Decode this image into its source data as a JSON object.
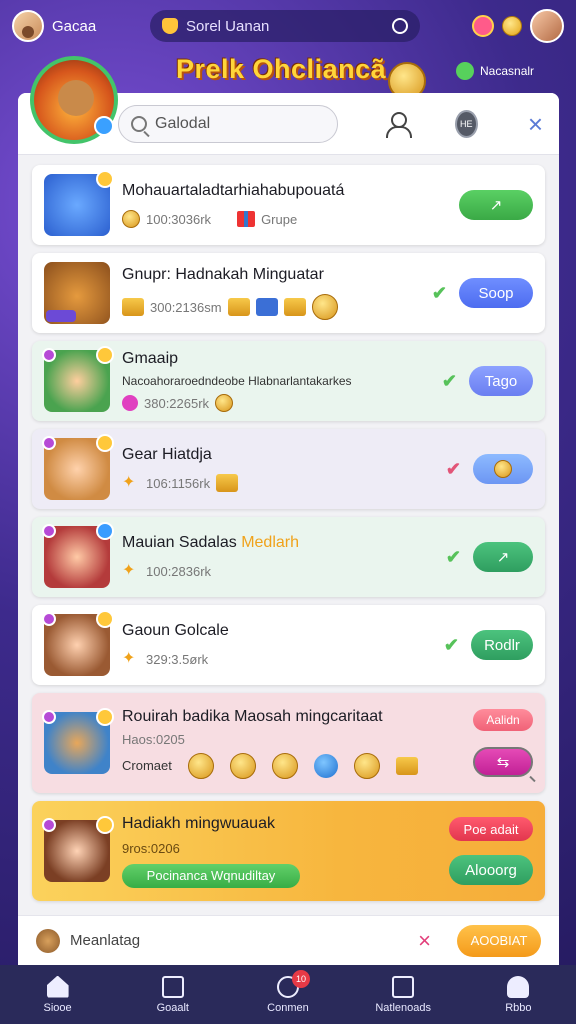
{
  "topbar": {
    "name": "Gacaa",
    "search_text": "Sorel Uanan"
  },
  "hero": {
    "title": "Prelk Ohcliancã",
    "tag": "Nacasnalr"
  },
  "panel": {
    "search_value": "Galodal",
    "circle_btn": "HE",
    "close": "×"
  },
  "cards": [
    {
      "title": "Mohauartaladtarhiahabupouatá",
      "amount": "100:3036rk",
      "extra": "Grupe",
      "button": "↗"
    },
    {
      "title": "Gnupr: Hadnakah Minguatar",
      "amount": "300:2136sm",
      "button": "Soop"
    },
    {
      "title": "Gmaaip",
      "desc": "Nacoahoraroedndeobe Hlabnarlantakarkes",
      "amount": "380:2265rk",
      "button": "Tago"
    },
    {
      "title": "Gear Hiatdja",
      "amount": "106:1156rk",
      "button": ""
    },
    {
      "title_a": "Mauian Sadalas ",
      "title_b": "Medlarh",
      "amount": "100:2836rk",
      "button": "↗"
    },
    {
      "title": "Gaoun Golcale",
      "amount": "329:3.5ørk",
      "button": "Rodlr"
    },
    {
      "title": "Rouirah badika Maosah mingcaritaat",
      "meta": "Haos:0205",
      "caption": "Cromaet",
      "tag": "Aalidn",
      "button": "⇆"
    },
    {
      "title": "Hadiakh mingwuauak",
      "meta": "9ros:0206",
      "bar": "Pocinanca Wqnudiltay",
      "tag": "Poe adait",
      "button": "Alooorg"
    }
  ],
  "footer": {
    "text": "Meanlatag",
    "close": "×",
    "button": "AOOBIAT"
  },
  "tabs": [
    {
      "label": "Siooe",
      "icon": "home-icon"
    },
    {
      "label": "Goaalt",
      "icon": "search-doc-icon"
    },
    {
      "label": "Conmen",
      "icon": "compass-icon",
      "badge": "10"
    },
    {
      "label": "Natlenoads",
      "icon": "chart-icon"
    },
    {
      "label": "Rbbo",
      "icon": "person-icon"
    }
  ]
}
